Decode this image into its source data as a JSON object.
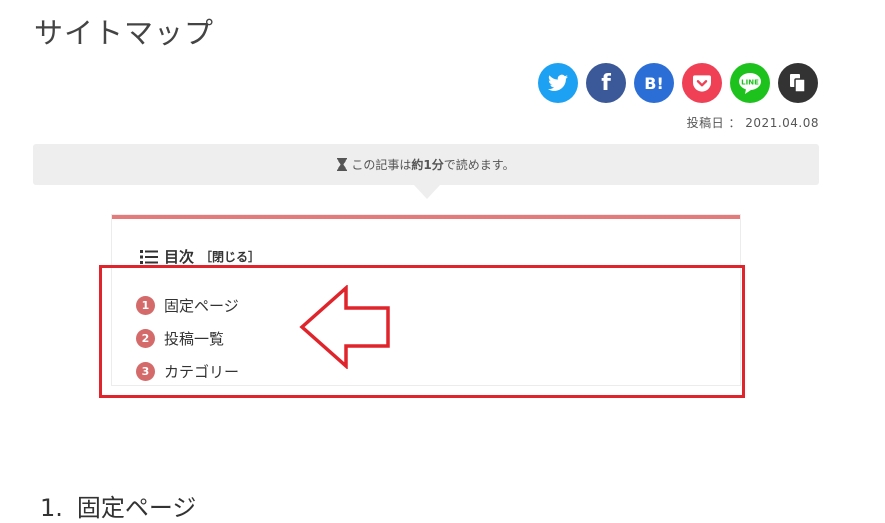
{
  "page": {
    "title": "サイトマップ"
  },
  "share": {
    "buttons": [
      {
        "name": "twitter",
        "icon": "twitter-bird-icon",
        "color": "#1da1f2"
      },
      {
        "name": "facebook",
        "icon": "facebook-f-icon",
        "label": "f",
        "color": "#3b5998"
      },
      {
        "name": "hatena",
        "icon": "hatena-bookmark-icon",
        "label": "B!",
        "color": "#2b6ed6"
      },
      {
        "name": "pocket",
        "icon": "pocket-icon",
        "color": "#ef4056"
      },
      {
        "name": "line",
        "icon": "line-icon",
        "color": "#1dc31c"
      },
      {
        "name": "copy",
        "icon": "copy-icon",
        "color": "#333333"
      }
    ]
  },
  "meta": {
    "posted": "投稿日 ： 2021.04.08"
  },
  "reading": {
    "prefix": "この記事は",
    "time": "約1分",
    "suffix": "で読めます。"
  },
  "toc": {
    "title": "目次",
    "toggle": "［閉じる］",
    "accent": "#e47a79",
    "items": [
      {
        "num": "1",
        "label": "固定ページ"
      },
      {
        "num": "2",
        "label": "投稿一覧"
      },
      {
        "num": "3",
        "label": "カテゴリー"
      }
    ]
  },
  "annotation": {
    "color": "#e0242b"
  },
  "section": {
    "number": "1.",
    "heading": "固定ページ"
  }
}
